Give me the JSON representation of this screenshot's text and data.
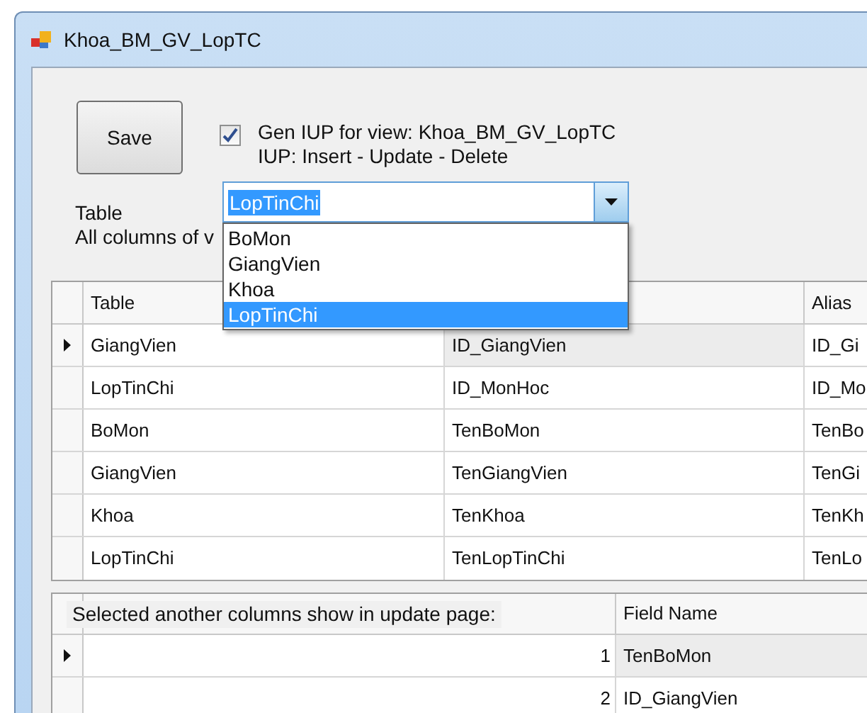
{
  "window": {
    "title": "Khoa_BM_GV_LopTC"
  },
  "save_button": {
    "label": "Save"
  },
  "gen_iup": {
    "checked": true,
    "label_lines": [
      "Gen IUP for view: Khoa_BM_GV_LopTC",
      "IUP: Insert - Update - Delete"
    ]
  },
  "table_label": "Table",
  "columns_label": "All columns of v",
  "table_combo": {
    "value": "LopTinChi",
    "expanded": true,
    "options": [
      {
        "label": "BoMon",
        "selected": false
      },
      {
        "label": "GiangVien",
        "selected": false
      },
      {
        "label": "Khoa",
        "selected": false
      },
      {
        "label": "LopTinChi",
        "selected": true
      }
    ]
  },
  "columns_grid": {
    "columns": [
      "Table",
      "",
      "Alias"
    ],
    "rows": [
      {
        "current": true,
        "cells": [
          "GiangVien",
          "ID_GiangVien",
          "ID_Gi"
        ]
      },
      {
        "current": false,
        "cells": [
          "LopTinChi",
          "ID_MonHoc",
          "ID_Mo"
        ]
      },
      {
        "current": false,
        "cells": [
          "BoMon",
          "TenBoMon",
          "TenBo"
        ]
      },
      {
        "current": false,
        "cells": [
          "GiangVien",
          "TenGiangVien",
          "TenGi"
        ]
      },
      {
        "current": false,
        "cells": [
          "Khoa",
          "TenKhoa",
          "TenKh"
        ]
      },
      {
        "current": false,
        "cells": [
          "LopTinChi",
          "TenLopTinChi",
          "TenLo"
        ]
      }
    ]
  },
  "update_grid": {
    "caption": "Selected another columns show in update page:",
    "columns": [
      "",
      "Field Name"
    ],
    "rows": [
      {
        "current": true,
        "cells": [
          "1",
          "TenBoMon"
        ]
      },
      {
        "current": false,
        "cells": [
          "2",
          "ID_GiangVien"
        ]
      }
    ]
  }
}
